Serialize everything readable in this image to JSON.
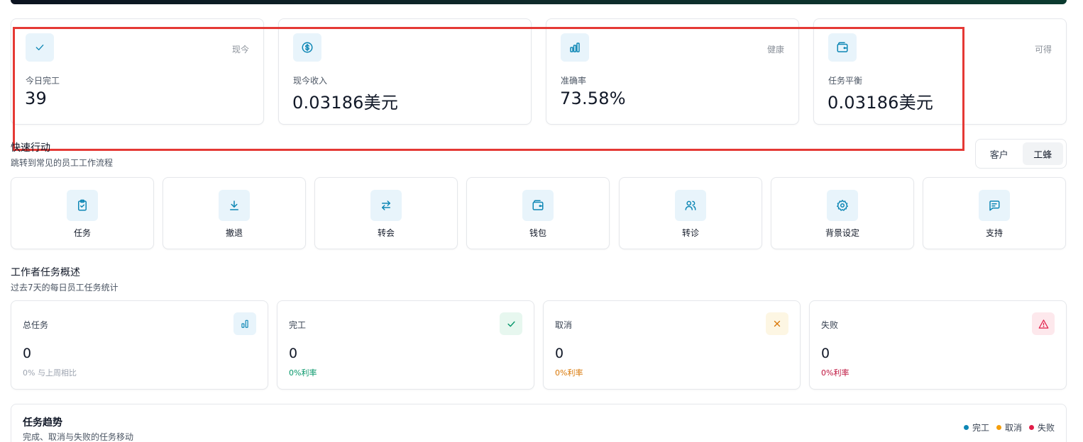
{
  "stats": [
    {
      "tag": "现今",
      "label": "今日完工",
      "value": "39",
      "icon": "check-icon"
    },
    {
      "tag": "",
      "label": "现今收入",
      "value": "0.03186美元",
      "icon": "dollar-circle-icon"
    },
    {
      "tag": "健康",
      "label": "准确率",
      "value": "73.58%",
      "icon": "bar-chart-icon"
    },
    {
      "tag": "可得",
      "label": "任务平衡",
      "value": "0.03186美元",
      "icon": "wallet-icon"
    }
  ],
  "quick_actions": {
    "title": "快速行动",
    "subtitle": "跳转到常见的员工工作流程",
    "toggle": {
      "options": [
        "客户",
        "工蜂"
      ],
      "active": "工蜂"
    },
    "items": [
      {
        "label": "任务",
        "icon": "clipboard-check-icon"
      },
      {
        "label": "撤退",
        "icon": "download-icon"
      },
      {
        "label": "转会",
        "icon": "transfer-arrows-icon"
      },
      {
        "label": "钱包",
        "icon": "wallet-icon"
      },
      {
        "label": "转诊",
        "icon": "users-icon"
      },
      {
        "label": "背景设定",
        "icon": "gear-icon"
      },
      {
        "label": "支持",
        "icon": "message-icon"
      }
    ]
  },
  "overview": {
    "title": "工作者任务概述",
    "subtitle": "过去7天的每日员工任务统计",
    "cards": [
      {
        "label": "总任务",
        "value": "0",
        "note": "0% 与上周相比",
        "icon": "bar-chart-icon",
        "color": "#9ca3af",
        "icon_bg": "#e8f4fb",
        "icon_color": "#0e87b5"
      },
      {
        "label": "完工",
        "value": "0",
        "note": "0%利率",
        "icon": "check-icon",
        "color": "#059669",
        "icon_bg": "#e7f7ef",
        "icon_color": "#059669"
      },
      {
        "label": "取消",
        "value": "0",
        "note": "0%利率",
        "icon": "x-icon",
        "color": "#d97706",
        "icon_bg": "#fdf6e3",
        "icon_color": "#d97706"
      },
      {
        "label": "失败",
        "value": "0",
        "note": "0%利率",
        "icon": "warning-icon",
        "color": "#be123c",
        "icon_bg": "#fde8ec",
        "icon_color": "#e11d48"
      }
    ]
  },
  "trend": {
    "title": "任务趋势",
    "subtitle": "完成、取消与失败的任务移动",
    "legend": [
      {
        "label": "完工",
        "color": "#0e87b5"
      },
      {
        "label": "取消",
        "color": "#f59e0b"
      },
      {
        "label": "失败",
        "color": "#e11d48"
      }
    ]
  }
}
